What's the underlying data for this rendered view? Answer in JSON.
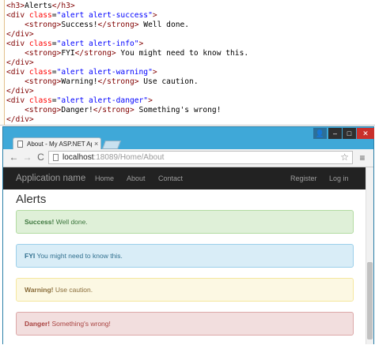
{
  "code": {
    "lines": [
      [
        {
          "t": "<h3>",
          "c": "tag"
        },
        {
          "t": "Alerts",
          "c": "txt"
        },
        {
          "t": "</h3>",
          "c": "tag"
        }
      ],
      [
        {
          "t": "<div ",
          "c": "tag"
        },
        {
          "t": "class",
          "c": "attr"
        },
        {
          "t": "=",
          "c": "txt"
        },
        {
          "t": "\"alert alert-success\"",
          "c": "val"
        },
        {
          "t": ">",
          "c": "tag"
        }
      ],
      [
        {
          "t": "    <strong>",
          "c": "tag"
        },
        {
          "t": "Success!",
          "c": "txt"
        },
        {
          "t": "</strong>",
          "c": "tag"
        },
        {
          "t": " Well done.",
          "c": "txt"
        }
      ],
      [
        {
          "t": "</div>",
          "c": "tag"
        }
      ],
      [
        {
          "t": "<div ",
          "c": "tag"
        },
        {
          "t": "class",
          "c": "attr"
        },
        {
          "t": "=",
          "c": "txt"
        },
        {
          "t": "\"alert alert-info\"",
          "c": "val"
        },
        {
          "t": ">",
          "c": "tag"
        }
      ],
      [
        {
          "t": "    <strong>",
          "c": "tag"
        },
        {
          "t": "FYI",
          "c": "txt"
        },
        {
          "t": "</strong>",
          "c": "tag"
        },
        {
          "t": " You might need to know this.",
          "c": "txt"
        }
      ],
      [
        {
          "t": "</div>",
          "c": "tag"
        }
      ],
      [
        {
          "t": "<div ",
          "c": "tag"
        },
        {
          "t": "class",
          "c": "attr"
        },
        {
          "t": "=",
          "c": "txt"
        },
        {
          "t": "\"alert alert-warning\"",
          "c": "val"
        },
        {
          "t": ">",
          "c": "tag"
        }
      ],
      [
        {
          "t": "    <strong>",
          "c": "tag"
        },
        {
          "t": "Warning!",
          "c": "txt"
        },
        {
          "t": "</strong>",
          "c": "tag"
        },
        {
          "t": " Use caution.",
          "c": "txt"
        }
      ],
      [
        {
          "t": "</div>",
          "c": "tag"
        }
      ],
      [
        {
          "t": "<div ",
          "c": "tag"
        },
        {
          "t": "class",
          "c": "attr"
        },
        {
          "t": "=",
          "c": "txt"
        },
        {
          "t": "\"alert alert-danger\"",
          "c": "val"
        },
        {
          "t": ">",
          "c": "tag"
        }
      ],
      [
        {
          "t": "    <strong>",
          "c": "tag"
        },
        {
          "t": "Danger!",
          "c": "txt"
        },
        {
          "t": "</strong>",
          "c": "tag"
        },
        {
          "t": " Something's wrong!",
          "c": "txt"
        }
      ],
      [
        {
          "t": "</div>",
          "c": "tag"
        }
      ]
    ]
  },
  "browser": {
    "tab_title": "About - My ASP.NET App",
    "tab_close": "×",
    "url_host": "localhost",
    "url_rest": ":18089/Home/About",
    "window_buttons": {
      "user": "👤",
      "minimize": "–",
      "maximize": "□",
      "close": "✕"
    },
    "icons": {
      "back": "←",
      "forward": "→",
      "reload": "C",
      "star": "☆",
      "menu": "≡"
    }
  },
  "site": {
    "brand": "Application name",
    "nav": {
      "home": "Home",
      "about": "About",
      "contact": "Contact",
      "register": "Register",
      "login": "Log in"
    },
    "heading": "Alerts",
    "alerts": {
      "success": {
        "strong": "Success!",
        "text": " Well done."
      },
      "info": {
        "strong": "FYI",
        "text": " You might need to know this."
      },
      "warning": {
        "strong": "Warning!",
        "text": " Use caution."
      },
      "danger": {
        "strong": "Danger!",
        "text": " Something's wrong!"
      }
    }
  },
  "colors": {
    "window_frame": "#3fa8d8",
    "navbar": "#222222",
    "success_bg": "#dff0d8",
    "info_bg": "#d9edf7",
    "warning_bg": "#fcf8e3",
    "danger_bg": "#f2dede"
  }
}
